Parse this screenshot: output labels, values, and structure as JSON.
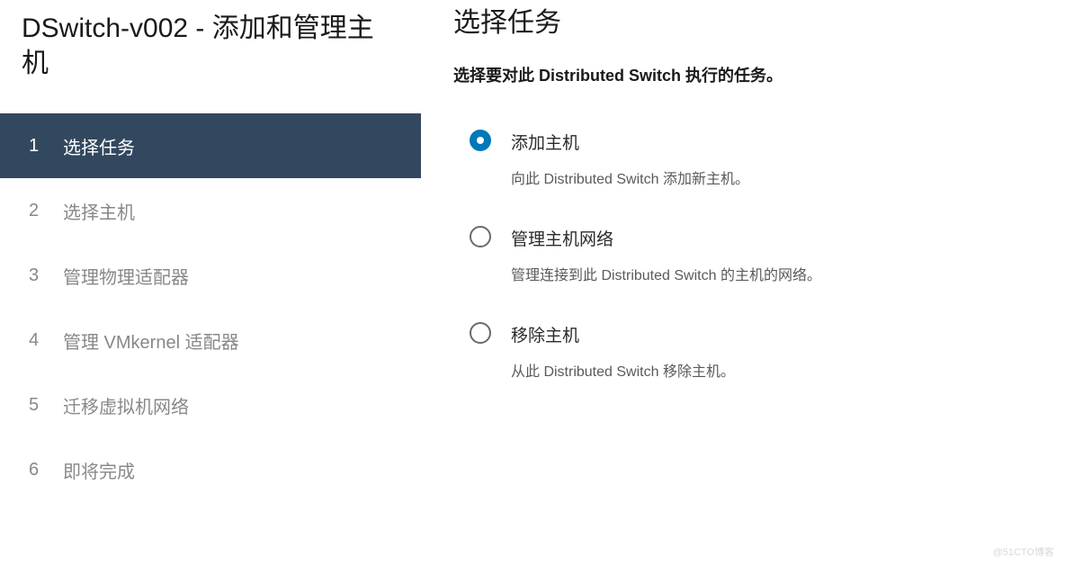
{
  "sidebar": {
    "title": "DSwitch-v002 - 添加和管理主机",
    "steps": [
      {
        "num": "1",
        "label": "选择任务",
        "active": true
      },
      {
        "num": "2",
        "label": "选择主机",
        "active": false
      },
      {
        "num": "3",
        "label": "管理物理适配器",
        "active": false
      },
      {
        "num": "4",
        "label": "管理 VMkernel 适配器",
        "active": false
      },
      {
        "num": "5",
        "label": "迁移虚拟机网络",
        "active": false
      },
      {
        "num": "6",
        "label": "即将完成",
        "active": false
      }
    ]
  },
  "main": {
    "title": "选择任务",
    "subtitle": "选择要对此 Distributed Switch 执行的任务。",
    "options": [
      {
        "label": "添加主机",
        "desc": "向此 Distributed Switch 添加新主机。",
        "selected": true
      },
      {
        "label": "管理主机网络",
        "desc": "管理连接到此 Distributed Switch 的主机的网络。",
        "selected": false
      },
      {
        "label": "移除主机",
        "desc": "从此 Distributed Switch 移除主机。",
        "selected": false
      }
    ]
  },
  "watermark": "@51CTO博客"
}
